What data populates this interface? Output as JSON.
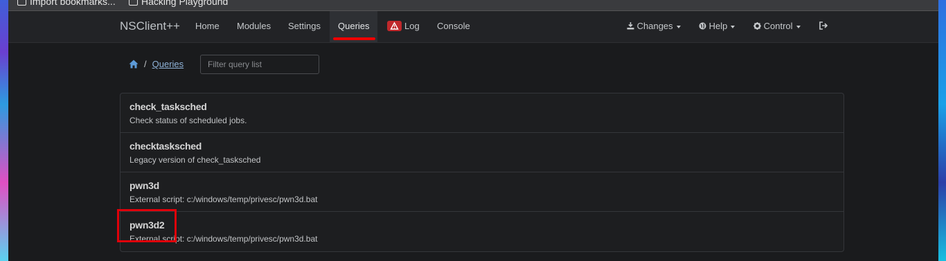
{
  "bookmarks": [
    {
      "label": "Import bookmarks..."
    },
    {
      "label": "Hacking Playground"
    }
  ],
  "navbar": {
    "brand": "NSClient++",
    "items": [
      {
        "label": "Home"
      },
      {
        "label": "Modules"
      },
      {
        "label": "Settings"
      },
      {
        "label": "Queries"
      },
      {
        "label": "Log"
      },
      {
        "label": "Console"
      }
    ],
    "active": "Queries",
    "right": [
      {
        "label": "Changes"
      },
      {
        "label": "Help"
      },
      {
        "label": "Control"
      }
    ]
  },
  "breadcrumb": {
    "separator": "/",
    "current": "Queries"
  },
  "filter": {
    "placeholder": "Filter query list",
    "value": ""
  },
  "queries": [
    {
      "name": "check_tasksched",
      "description": "Check status of scheduled jobs."
    },
    {
      "name": "checktasksched",
      "description": "Legacy version of check_tasksched"
    },
    {
      "name": "pwn3d",
      "description": "External script: c:/windows/temp/privesc/pwn3d.bat"
    },
    {
      "name": "pwn3d2",
      "description": "External script: c:/windows/temp/privesc/pwn3d.bat"
    }
  ],
  "colors": {
    "accent_red": "#e0000a",
    "link": "#8fb3d9",
    "badge": "#c0282b"
  }
}
